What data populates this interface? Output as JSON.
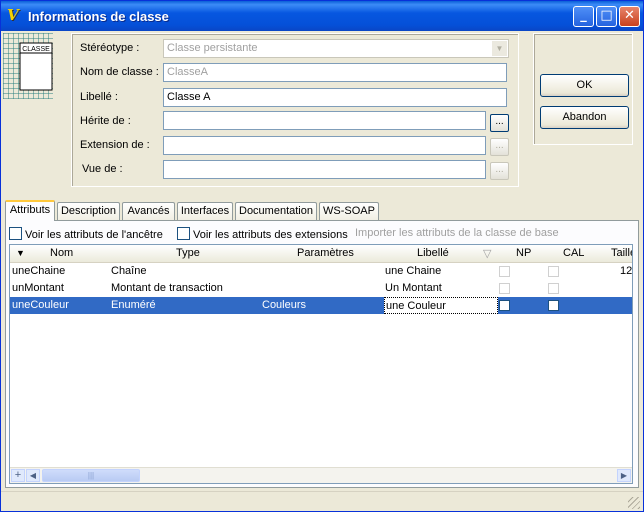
{
  "window": {
    "title": "Informations de classe",
    "app_icon": "V-italic-logo",
    "buttons": {
      "minimize": "_",
      "maximize": "□",
      "close": "✕"
    }
  },
  "class_icon": {
    "text": "CLASSE"
  },
  "form": {
    "stereotype": {
      "label": "Stéréotype :",
      "value": "Classe persistante"
    },
    "class_name": {
      "label": "Nom de classe :",
      "value": "ClasseA"
    },
    "caption": {
      "label": "Libellé :",
      "value": "Classe A"
    },
    "inherits": {
      "label": "Hérite de :",
      "value": "",
      "browse": "..."
    },
    "extension": {
      "label": "Extension de :",
      "value": "",
      "browse": "..."
    },
    "view": {
      "label": "Vue de :",
      "value": "",
      "browse": "..."
    }
  },
  "actions": {
    "ok": "OK",
    "cancel": "Abandon"
  },
  "tabs": [
    "Attributs",
    "Description",
    "Avancés",
    "Interfaces",
    "Documentation",
    "WS-SOAP"
  ],
  "options": {
    "show_ancestor": "Voir les attributs de l'ancêtre",
    "show_extensions": "Voir les attributs des extensions",
    "import_base": "Importer les attributs de la classe de base"
  },
  "grid": {
    "columns": [
      "Nom",
      "Type",
      "Paramètres",
      "Libellé",
      "NP",
      "CAL",
      "Taille"
    ],
    "sort_indicator": "▼",
    "filter_icon": "▽",
    "rows": [
      {
        "name": "uneChaine",
        "type": "Chaîne",
        "params": "",
        "caption": "une Chaine",
        "size": "12"
      },
      {
        "name": "unMontant",
        "type": "Montant de transaction",
        "params": "",
        "caption": "Un Montant",
        "size": ""
      },
      {
        "name": "uneCouleur",
        "type": "Enuméré",
        "params": "Couleurs",
        "caption": "une Couleur",
        "size": ""
      }
    ],
    "add_button": "+"
  },
  "colors": {
    "selection": "#316ac5",
    "titlebar": "#0757e0"
  }
}
